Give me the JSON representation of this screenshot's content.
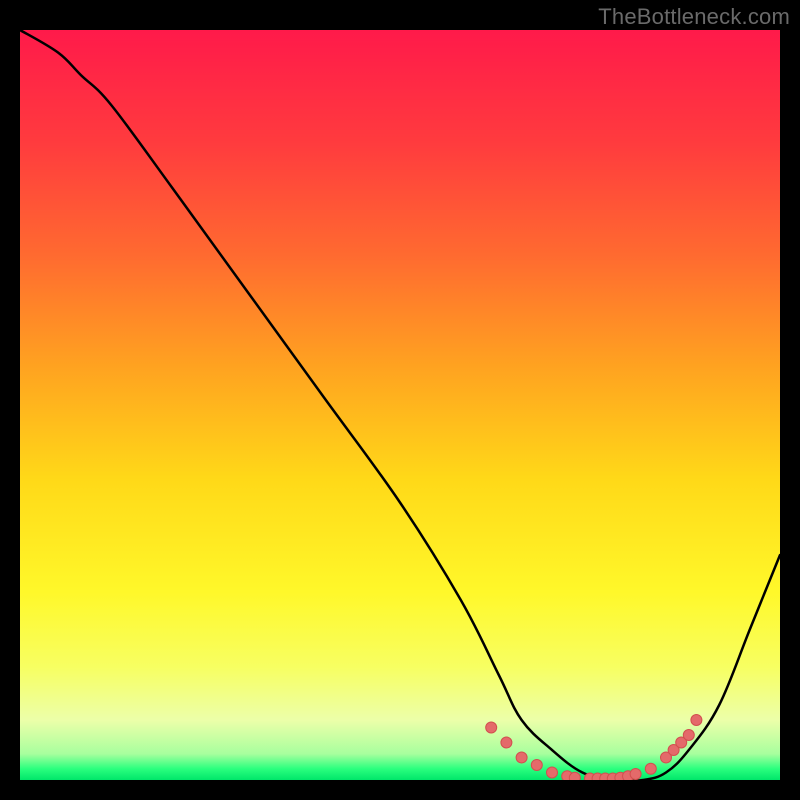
{
  "attribution": "TheBottleneck.com",
  "colors": {
    "bg": "#000000",
    "attribution_text": "#6a6a6a",
    "curve": "#000000",
    "marker_fill": "#e46a6a",
    "marker_stroke": "#d24f4f",
    "gradient_stops": [
      {
        "offset": 0.0,
        "color": "#ff1a4a"
      },
      {
        "offset": 0.15,
        "color": "#ff3b3e"
      },
      {
        "offset": 0.3,
        "color": "#ff6a30"
      },
      {
        "offset": 0.45,
        "color": "#ffa320"
      },
      {
        "offset": 0.6,
        "color": "#ffd918"
      },
      {
        "offset": 0.75,
        "color": "#fff82a"
      },
      {
        "offset": 0.85,
        "color": "#f7ff62"
      },
      {
        "offset": 0.92,
        "color": "#ecffa9"
      },
      {
        "offset": 0.965,
        "color": "#a8ff9e"
      },
      {
        "offset": 0.985,
        "color": "#2bff7e"
      },
      {
        "offset": 1.0,
        "color": "#00e66a"
      }
    ]
  },
  "chart_data": {
    "type": "line",
    "title": "",
    "xlabel": "",
    "ylabel": "",
    "xlim": [
      0,
      100
    ],
    "ylim": [
      0,
      100
    ],
    "grid": false,
    "legend": null,
    "series": [
      {
        "name": "bottleneck-curve",
        "x": [
          0,
          5,
          8,
          12,
          20,
          30,
          40,
          50,
          58,
          63,
          66,
          70,
          74,
          78,
          82,
          85,
          88,
          92,
          96,
          100
        ],
        "values": [
          100,
          97,
          94,
          90,
          79,
          65,
          51,
          37,
          24,
          14,
          8,
          4,
          1,
          0,
          0,
          1,
          4,
          10,
          20,
          30
        ]
      }
    ],
    "markers": {
      "series": "bottleneck-curve",
      "points_x": [
        62,
        64,
        66,
        68,
        70,
        72,
        73,
        75,
        76,
        77,
        78,
        79,
        80,
        81,
        83,
        85,
        86,
        87,
        88,
        89
      ],
      "points_y": [
        7,
        5,
        3,
        2,
        1,
        0.5,
        0.3,
        0.2,
        0.2,
        0.2,
        0.2,
        0.3,
        0.5,
        0.8,
        1.5,
        3,
        4,
        5,
        6,
        8
      ]
    }
  }
}
